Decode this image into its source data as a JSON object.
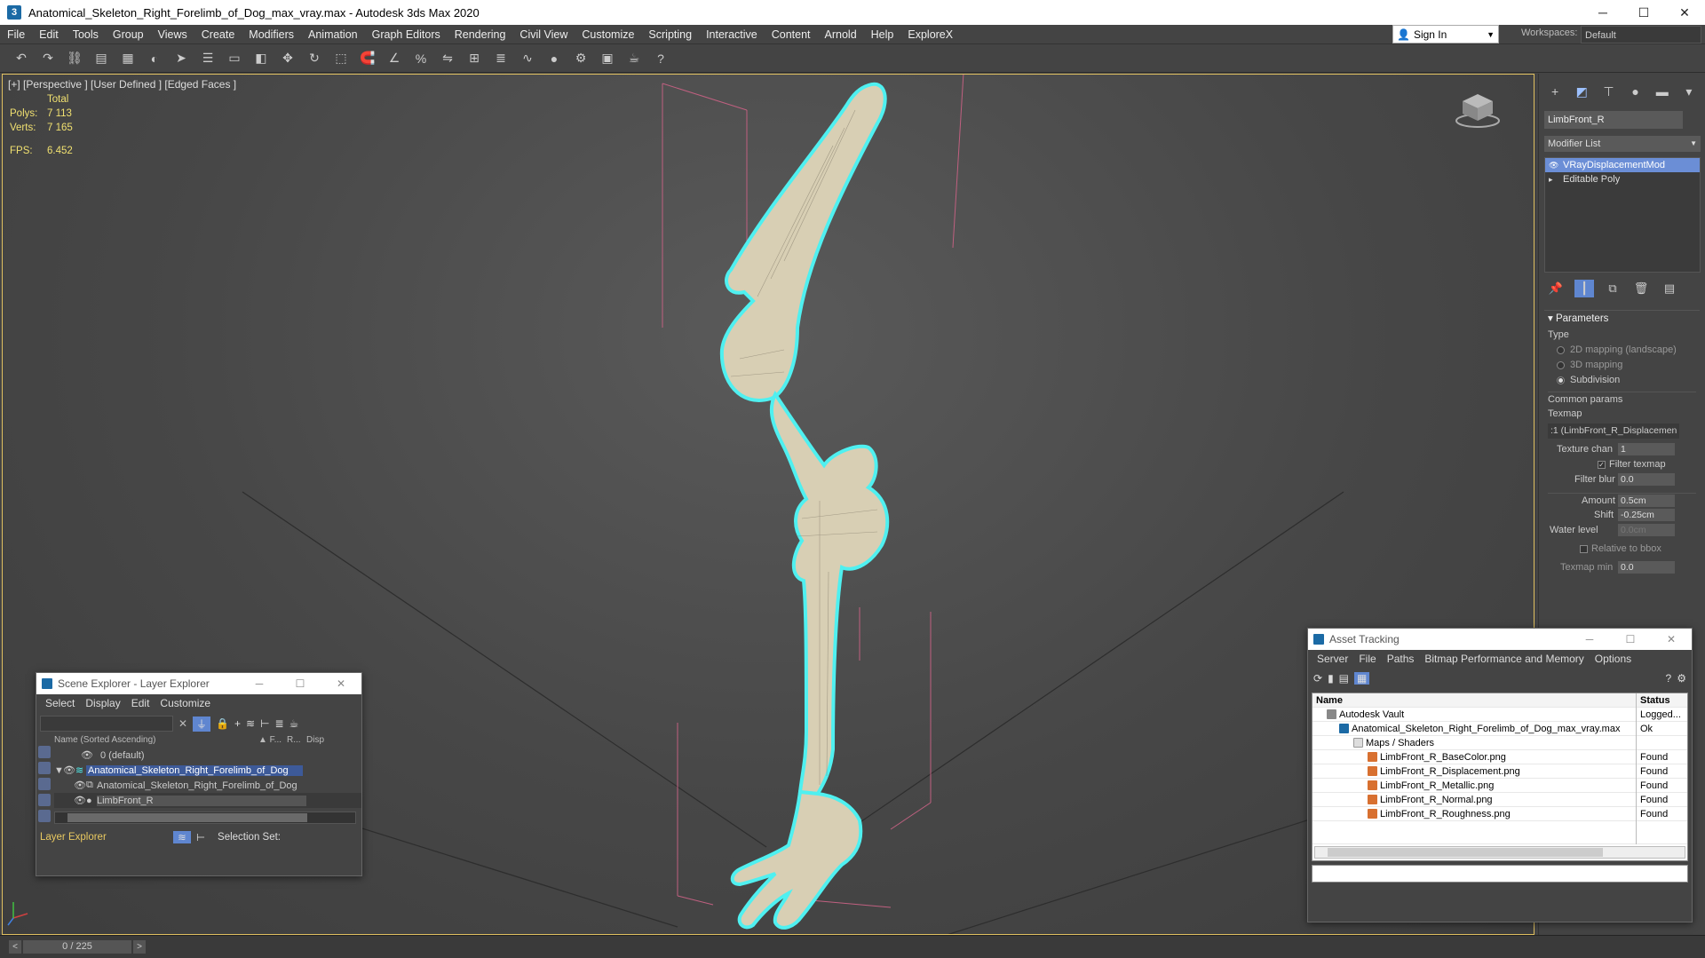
{
  "window": {
    "app_icon": "3",
    "title": "Anatomical_Skeleton_Right_Forelimb_of_Dog_max_vray.max - Autodesk 3ds Max 2020",
    "minimize": "─",
    "maximize": "☐",
    "close": "✕"
  },
  "menu": [
    "File",
    "Edit",
    "Tools",
    "Group",
    "Views",
    "Create",
    "Modifiers",
    "Animation",
    "Graph Editors",
    "Rendering",
    "Civil View",
    "Customize",
    "Scripting",
    "Interactive",
    "Content",
    "Arnold",
    "Help",
    "ExploreX"
  ],
  "signin": {
    "label": "Sign In"
  },
  "workspace": {
    "label": "Workspaces:",
    "value": "Default"
  },
  "viewport": {
    "label": "[+] [Perspective ] [User Defined ] [Edged Faces ]",
    "stats": {
      "header": "Total",
      "polys_label": "Polys:",
      "polys": "7 113",
      "verts_label": "Verts:",
      "verts": "7 165",
      "fps_label": "FPS:",
      "fps": "6.452"
    }
  },
  "command_panel": {
    "object_name": "LimbFront_R",
    "modifier_list": "Modifier List",
    "stack": [
      {
        "label": "VRayDisplacementMod",
        "active": true
      },
      {
        "label": "Editable Poly",
        "active": false
      }
    ],
    "rollout": "Parameters",
    "type_label": "Type",
    "types": [
      {
        "label": "2D mapping (landscape)",
        "selected": false
      },
      {
        "label": "3D mapping",
        "selected": false
      },
      {
        "label": "Subdivision",
        "selected": true
      }
    ],
    "common_params": "Common params",
    "texmap_label": "Texmap",
    "texmap_value": ":1 (LimbFront_R_Displacemen",
    "texture_chan_label": "Texture chan",
    "texture_chan": "1",
    "filter_texmap": "Filter texmap",
    "filter_blur_label": "Filter blur",
    "filter_blur": "0.0",
    "amount_label": "Amount",
    "amount": "0.5cm",
    "shift_label": "Shift",
    "shift": "-0.25cm",
    "water_level_label": "Water level",
    "water_level": "0.0cm",
    "relative_bbox": "Relative to bbox",
    "texmap_min_label": "Texmap min",
    "texmap_min": "0.0"
  },
  "scene_explorer": {
    "title": "Scene Explorer - Layer Explorer",
    "menu": [
      "Select",
      "Display",
      "Edit",
      "Customize"
    ],
    "col_name": "Name (Sorted Ascending)",
    "col_f": "▲ F...",
    "col_r": "R...",
    "col_d": "Disp",
    "rows": [
      {
        "label": "0 (default)",
        "indent": 0
      },
      {
        "label": "Anatomical_Skeleton_Right_Forelimb_of_Dog",
        "indent": 0,
        "highlight": true
      },
      {
        "label": "Anatomical_Skeleton_Right_Forelimb_of_Dog",
        "indent": 1
      },
      {
        "label": "LimbFront_R",
        "indent": 1,
        "selected": true
      }
    ],
    "footer_explorer": "Layer Explorer",
    "footer_selection": "Selection Set:"
  },
  "asset_tracking": {
    "title": "Asset Tracking",
    "menu": [
      "Server",
      "File",
      "Paths",
      "Bitmap Performance and Memory",
      "Options"
    ],
    "col_name": "Name",
    "col_status": "Status",
    "rows": [
      {
        "name": "Autodesk Vault",
        "status": "Logged...",
        "indent": 1,
        "icon": "vault"
      },
      {
        "name": "Anatomical_Skeleton_Right_Forelimb_of_Dog_max_vray.max",
        "status": "Ok",
        "indent": 2,
        "icon": "max"
      },
      {
        "name": "Maps / Shaders",
        "status": "",
        "indent": 3,
        "icon": "folder"
      },
      {
        "name": "LimbFront_R_BaseColor.png",
        "status": "Found",
        "indent": 4,
        "icon": "image"
      },
      {
        "name": "LimbFront_R_Displacement.png",
        "status": "Found",
        "indent": 4,
        "icon": "image"
      },
      {
        "name": "LimbFront_R_Metallic.png",
        "status": "Found",
        "indent": 4,
        "icon": "image"
      },
      {
        "name": "LimbFront_R_Normal.png",
        "status": "Found",
        "indent": 4,
        "icon": "image"
      },
      {
        "name": "LimbFront_R_Roughness.png",
        "status": "Found",
        "indent": 4,
        "icon": "image"
      }
    ]
  },
  "timeline": {
    "frame": "0 / 225"
  },
  "colors": {
    "accent": "#e8c860",
    "selection": "#6b8ed6",
    "wire": "#4ff0f0",
    "bone": "#d8cfb4"
  }
}
